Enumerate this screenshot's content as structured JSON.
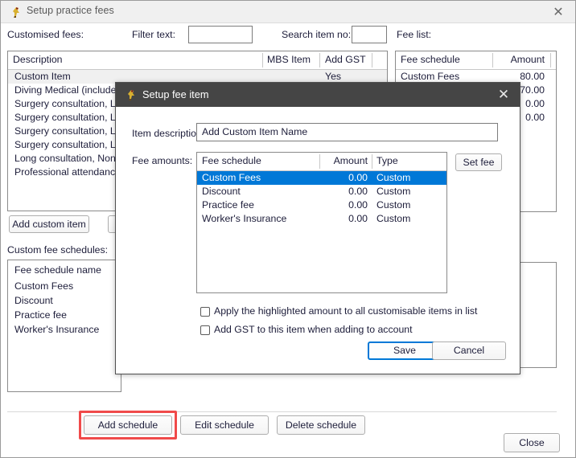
{
  "window": {
    "title": "Setup practice fees",
    "icon": "bird-icon",
    "close": "✕"
  },
  "toolbar": {
    "customised_fees_label": "Customised fees:",
    "filter_text_label": "Filter text:",
    "filter_text_value": "",
    "search_item_no_label": "Search item no:",
    "search_item_no_value": "",
    "fee_list_label": "Fee list:"
  },
  "items_grid": {
    "columns": [
      "Description",
      "MBS Item",
      "Add GST"
    ],
    "rows": [
      {
        "description": "Custom Item",
        "mbs_item": "",
        "add_gst": "Yes",
        "selected": true
      },
      {
        "description": "Diving Medical (include an E",
        "mbs_item": "",
        "add_gst": ""
      },
      {
        "description": "Surgery consultation, Level ",
        "mbs_item": "",
        "add_gst": ""
      },
      {
        "description": "Surgery consultation, Level ",
        "mbs_item": "",
        "add_gst": ""
      },
      {
        "description": "Surgery consultation, Level ",
        "mbs_item": "",
        "add_gst": ""
      },
      {
        "description": "Surgery consultation, Level ",
        "mbs_item": "",
        "add_gst": ""
      },
      {
        "description": "Long consultation, Non VR ",
        "mbs_item": "",
        "add_gst": ""
      },
      {
        "description": "Professional attendance by ",
        "mbs_item": "",
        "add_gst": ""
      }
    ]
  },
  "fee_list_grid": {
    "columns": [
      "Fee schedule",
      "Amount"
    ],
    "rows": [
      {
        "schedule": "Custom Fees",
        "amount": "80.00"
      },
      {
        "schedule": "",
        "amount": "70.00"
      },
      {
        "schedule": "",
        "amount": "0.00"
      },
      {
        "schedule": "",
        "amount": "0.00"
      }
    ]
  },
  "left_panel": {
    "add_custom_item_label": "Add custom item",
    "custom_fee_schedules_label": "Custom fee schedules:",
    "schedules_column": "Fee schedule name",
    "schedules": [
      "Custom Fees",
      "Discount",
      "Practice fee",
      "Worker's Insurance"
    ]
  },
  "bottom_bar": {
    "add_schedule_label": "Add schedule",
    "edit_schedule_label": "Edit schedule",
    "delete_schedule_label": "Delete schedule",
    "close_label": "Close"
  },
  "dialog": {
    "title": "Setup fee item",
    "icon": "bird-icon",
    "close": "✕",
    "item_description_label": "Item description:",
    "item_description_value": "Add Custom Item Name",
    "fee_amounts_label": "Fee amounts:",
    "set_fee_label": "Set fee",
    "fee_grid": {
      "columns": [
        "Fee schedule",
        "Amount",
        "Type"
      ],
      "rows": [
        {
          "schedule": "Custom Fees",
          "amount": "0.00",
          "type": "Custom",
          "selected": true
        },
        {
          "schedule": "Discount",
          "amount": "0.00",
          "type": "Custom",
          "selected": false
        },
        {
          "schedule": "Practice fee",
          "amount": "0.00",
          "type": "Custom",
          "selected": false
        },
        {
          "schedule": "Worker's Insurance",
          "amount": "0.00",
          "type": "Custom",
          "selected": false
        }
      ]
    },
    "checkbox_apply_label": "Apply the highlighted amount to all customisable items in list",
    "checkbox_apply_checked": false,
    "checkbox_gst_label": "Add GST to this item when adding to account",
    "checkbox_gst_checked": false,
    "save_label": "Save",
    "cancel_label": "Cancel"
  },
  "colors": {
    "selection_blue": "#0078d7",
    "dialog_titlebar": "#454545",
    "annotation_red": "#f04a4a"
  }
}
